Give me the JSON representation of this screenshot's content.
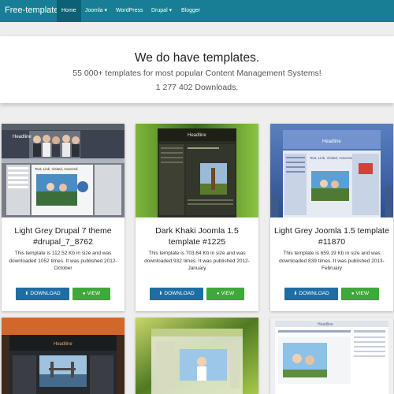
{
  "navbar": {
    "brand": "Free-templates.lt",
    "items": [
      {
        "label": "Home"
      },
      {
        "label": "Joomla ▾"
      },
      {
        "label": "WordPress"
      },
      {
        "label": "Drupal ▾"
      },
      {
        "label": "Blogger"
      }
    ]
  },
  "hero": {
    "title": "We do have templates.",
    "subtitle": "55 000+ templates for most popular Content Management Systems!",
    "downloads": "1 277 402 Downloads."
  },
  "buttons": {
    "download": "DOWNLOAD",
    "view": "VIEW",
    "download_icon": "download-icon",
    "view_icon": "eye-icon"
  },
  "cards": [
    {
      "title": "Light Grey Drupal 7 theme #drupal_7_8762",
      "desc": "This template is 112.52 Kb in size and was downloaded 1052 times. It was published 2012-October"
    },
    {
      "title": "Dark Khaki Joomla 1.5 template #1225",
      "desc": "This template is 703.64 Kb in size and was downloaded 932 times. It was published 2012-January"
    },
    {
      "title": "Light Grey Joomla 1.5 template #11870",
      "desc": "This template is 659.19 Kb in size and was downloaded 839 times. It was published 2013-February"
    }
  ],
  "thumbs": {
    "t1": {
      "headline": "Headline",
      "post": "Text, Link, Visited, Hovered"
    },
    "t2": {
      "headline": "Headline"
    },
    "t3": {
      "headline": "Headline",
      "post": "Text, Link, Visited, Hovered"
    },
    "t4": {
      "headline": "Headline"
    },
    "t6": {
      "headline": "Headline"
    }
  },
  "colors": {
    "navbar": "#177e96",
    "nav_active": "#0c6174",
    "download_button": "#1f6ea3",
    "view_button": "#3ea83a"
  }
}
